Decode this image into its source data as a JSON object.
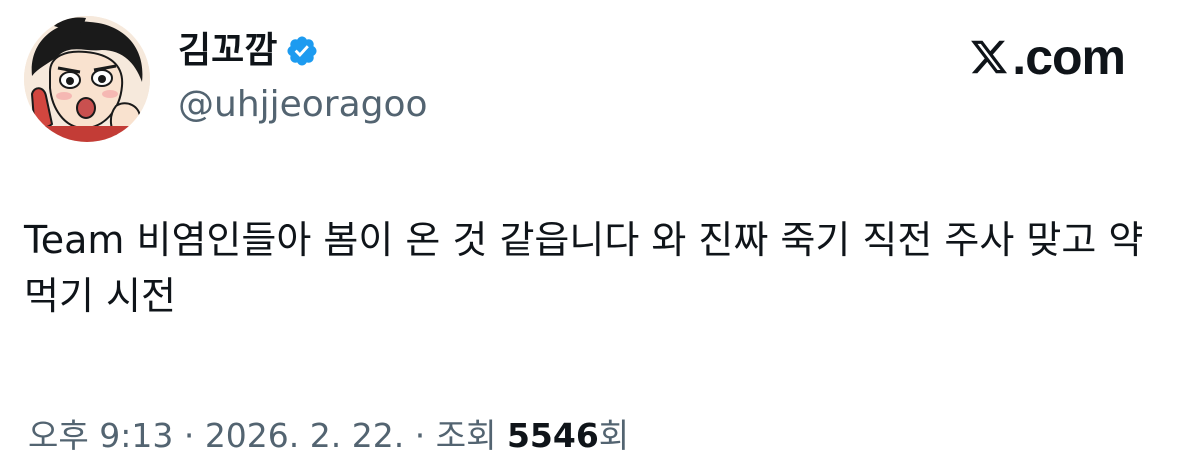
{
  "author": {
    "display_name": "김꼬깜",
    "handle": "@uhjjeoragoo",
    "verified": true,
    "avatar_icon": "manga-character-avatar"
  },
  "brand": {
    "logo_icon": "x-logo-icon",
    "text": ".com"
  },
  "tweet": {
    "text": "Team 비염인들아 봄이 온 것 같읍니다 와 진짜 죽기 직전 주사 맞고 약 먹기 시전"
  },
  "meta": {
    "time": "오후 9:13",
    "separator1": " · ",
    "date": "2026. 2. 22.",
    "separator2": " · ",
    "views_label": "조회 ",
    "views_count": "5546",
    "views_suffix": "회"
  },
  "colors": {
    "text_primary": "#0f1419",
    "text_secondary": "#536471",
    "verified_blue": "#1d9bf0"
  }
}
